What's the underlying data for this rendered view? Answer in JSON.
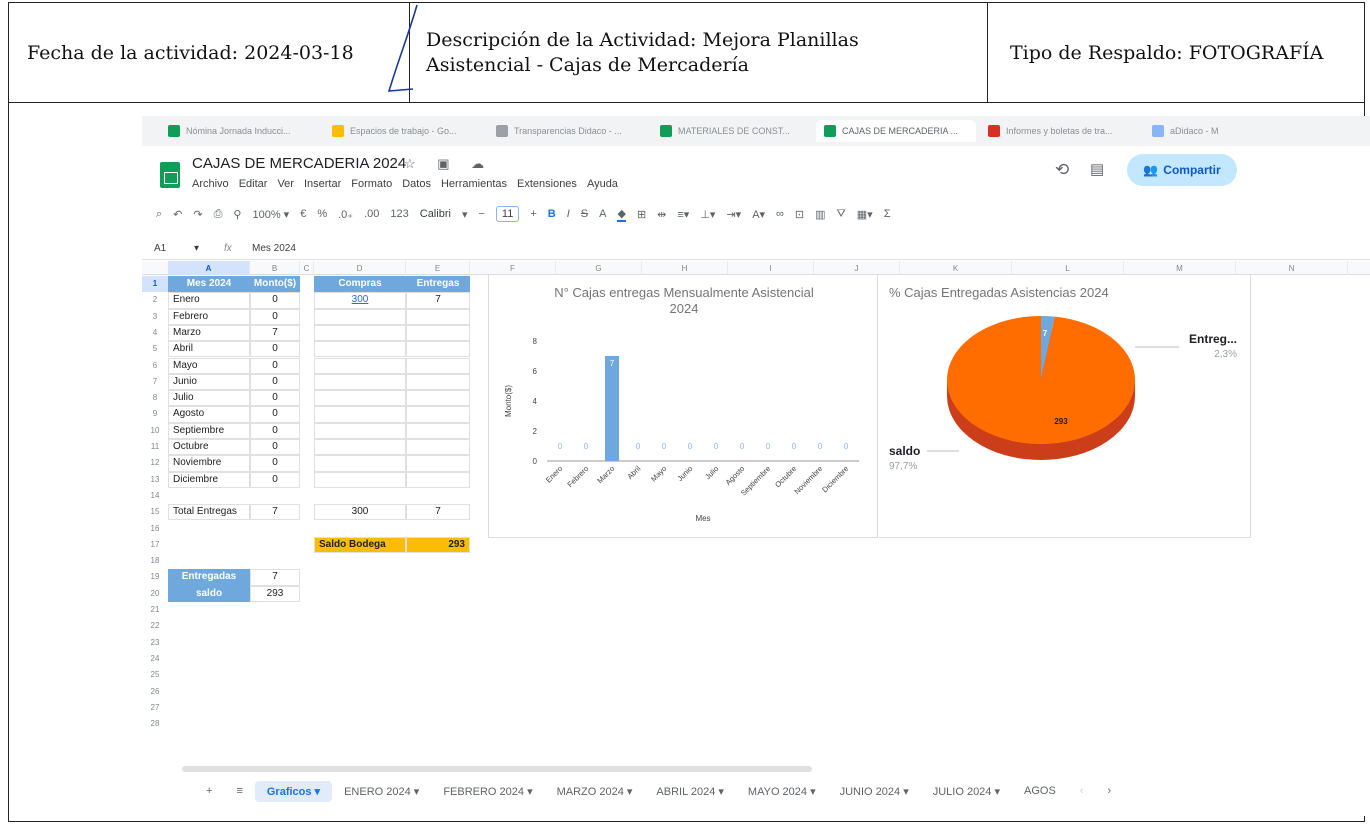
{
  "doc_header": {
    "fecha": "Fecha de la actividad: 2024-03-18",
    "descripcion_line1": "Descripción de la Actividad: Mejora Planillas",
    "descripcion_line2": "Asistencial - Cajas de Mercadería",
    "respaldo": "Tipo de Respaldo: FOTOGRAFÍA"
  },
  "browser_tabs": [
    {
      "label": "Nómina Jornada Inducci...",
      "color": "#0f9d58"
    },
    {
      "label": "Espacios de trabajo - Go...",
      "color": "#fbbc04"
    },
    {
      "label": "Transparencias Didaco - ...",
      "color": "#9aa0a6"
    },
    {
      "label": "MATERIALES DE CONST...",
      "color": "#0f9d58"
    },
    {
      "label": "CAJAS DE MERCADERIA ...",
      "color": "#0f9d58"
    },
    {
      "label": "Informes y boletas de tra...",
      "color": "#d93025"
    },
    {
      "label": "aDidaco - M",
      "color": "#8ab4f8"
    }
  ],
  "app": {
    "title": "CAJAS DE MERCADERIA 2024",
    "title_icons": "☆ ▣ ☁",
    "menu": [
      "Archivo",
      "Editar",
      "Ver",
      "Insertar",
      "Formato",
      "Datos",
      "Herramientas",
      "Extensiones",
      "Ayuda"
    ],
    "share_label": "Compartir",
    "share_icon": "👥"
  },
  "toolbar": {
    "zoom": "100% ▾",
    "currency": "€",
    "percent": "%",
    "dec_less": ".0₊",
    "dec_more": ".00",
    "num_format": "123",
    "font": "Calibri",
    "size": "11"
  },
  "formula_bar": {
    "cell_ref": "A1",
    "fx": "fx",
    "value": "Mes 2024"
  },
  "columns": [
    "A",
    "B",
    "C",
    "D",
    "E",
    "F",
    "G",
    "H",
    "I",
    "J",
    "K",
    "L",
    "M",
    "N"
  ],
  "rows": [
    "1",
    "2",
    "3",
    "4",
    "5",
    "6",
    "7",
    "8",
    "9",
    "10",
    "11",
    "12",
    "13",
    "14",
    "15",
    "16",
    "17",
    "18",
    "19",
    "20",
    "21",
    "22",
    "23",
    "24",
    "25",
    "26",
    "27",
    "28"
  ],
  "table_months": {
    "header_mes": "Mes 2024",
    "header_monto": "Monto($)",
    "rows": [
      {
        "mes": "Enero",
        "monto": "0"
      },
      {
        "mes": "Febrero",
        "monto": "0"
      },
      {
        "mes": "Marzo",
        "monto": "7"
      },
      {
        "mes": "Abril",
        "monto": "0"
      },
      {
        "mes": "Mayo",
        "monto": "0"
      },
      {
        "mes": "Junio",
        "monto": "0"
      },
      {
        "mes": "Julio",
        "monto": "0"
      },
      {
        "mes": "Agosto",
        "monto": "0"
      },
      {
        "mes": "Septiembre",
        "monto": "0"
      },
      {
        "mes": "Octubre",
        "monto": "0"
      },
      {
        "mes": "Noviembre",
        "monto": "0"
      },
      {
        "mes": "Diciembre",
        "monto": "0"
      }
    ],
    "total_label": "Total Entregas",
    "total_value": "7"
  },
  "table_compras": {
    "header_compras": "Compras",
    "header_entregas": "Entregas",
    "compras_value": "300",
    "entregas_value": "7",
    "total_compras": "300",
    "total_entregas": "7",
    "saldo_label": "Saldo Bodega",
    "saldo_value": "293"
  },
  "table_summary": {
    "entregadas_label": "Entregadas",
    "entregadas_value": "7",
    "saldo_label": "saldo",
    "saldo_value": "293"
  },
  "chart_data": [
    {
      "type": "bar",
      "title": "N° Cajas entregas Mensualmente Asistencial 2024",
      "xlabel": "Mes",
      "ylabel": "Monto($)",
      "ylim": [
        0,
        8
      ],
      "yticks": [
        "0",
        "2",
        "4",
        "6",
        "8"
      ],
      "categories": [
        "Enero",
        "Febrero",
        "Marzo",
        "Abril",
        "Mayo",
        "Junio",
        "Julio",
        "Agosto",
        "Septiembre",
        "Octubre",
        "Noviembre",
        "Diciembre"
      ],
      "values": [
        0,
        0,
        7,
        0,
        0,
        0,
        0,
        0,
        0,
        0,
        0,
        0
      ],
      "value_labels": [
        "0",
        "0",
        "7",
        "0",
        "0",
        "0",
        "0",
        "0",
        "0",
        "0",
        "0",
        "0"
      ],
      "color": "#6fa8dc"
    },
    {
      "type": "pie",
      "title": "% Cajas Entregadas Asistencias 2024",
      "slices": [
        {
          "label": "Entreg...",
          "value": 7,
          "value_label": "7",
          "percent": "2,3%",
          "color": "#6fa8dc"
        },
        {
          "label": "saldo",
          "value": 293,
          "value_label": "293",
          "percent": "97,7%",
          "color": "#ff6d01"
        }
      ]
    }
  ],
  "sheet_tabs": {
    "add": "+",
    "list": "≡",
    "tabs": [
      "Graficos ▾",
      "ENERO 2024 ▾",
      "FEBRERO 2024 ▾",
      "MARZO 2024 ▾",
      "ABRIL 2024 ▾",
      "MAYO 2024 ▾",
      "JUNIO 2024 ▾",
      "JULIO 2024 ▾",
      "AGOS"
    ],
    "nav_prev": "‹",
    "nav_next": "›"
  }
}
